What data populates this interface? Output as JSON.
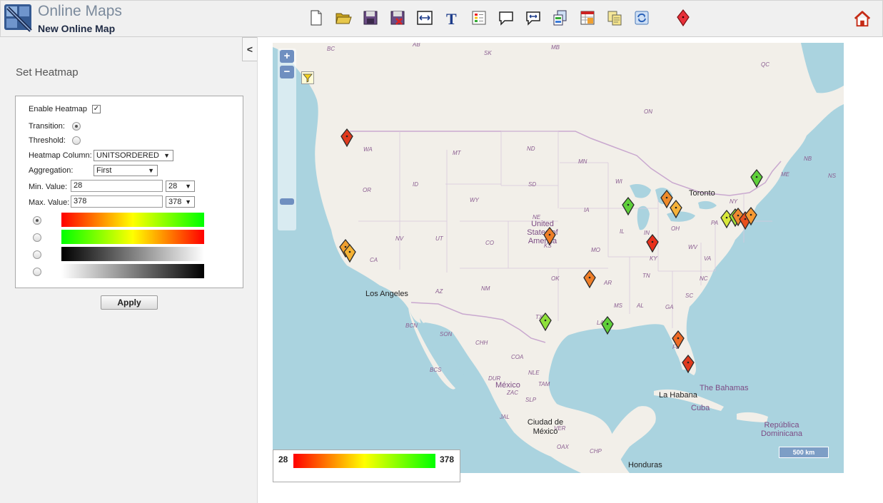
{
  "header": {
    "app_title": "Online Maps",
    "map_name": "New Online Map",
    "toolbar": [
      {
        "name": "new-document-icon",
        "title": "New"
      },
      {
        "name": "open-folder-icon",
        "title": "Open"
      },
      {
        "name": "save-icon",
        "title": "Save"
      },
      {
        "name": "save-as-icon",
        "title": "Save As"
      },
      {
        "name": "resize-icon",
        "title": "Resize"
      },
      {
        "name": "text-icon",
        "title": "Text"
      },
      {
        "name": "legend-icon",
        "title": "Legend"
      },
      {
        "name": "callout-icon",
        "title": "Callout"
      },
      {
        "name": "callout-arrows-icon",
        "title": "Callout Arrows"
      },
      {
        "name": "layer-export-icon",
        "title": "Export"
      },
      {
        "name": "layer-table-icon",
        "title": "Table"
      },
      {
        "name": "copy-icon",
        "title": "Copy"
      },
      {
        "name": "refresh-icon",
        "title": "Refresh"
      },
      {
        "name": "marker-icon",
        "title": "Marker"
      }
    ],
    "home_icon": "home-icon"
  },
  "panel": {
    "collapse_label": "<",
    "title": "Set Heatmap",
    "enable_label": "Enable Heatmap",
    "enable_checked": true,
    "transition_label": "Transition:",
    "threshold_label": "Threshold:",
    "mode_selected": "transition",
    "column_label": "Heatmap Column:",
    "column_value": "UNITSORDERED",
    "aggregation_label": "Aggregation:",
    "aggregation_value": "First",
    "min_label": "Min. Value:",
    "min_value": "28",
    "min_select": "28",
    "max_label": "Max. Value:",
    "max_value": "378",
    "max_select": "378",
    "palettes": [
      "red-yellow-green",
      "green-yellow-red",
      "black-white",
      "white-black"
    ],
    "palette_selected": 0,
    "apply_label": "Apply"
  },
  "map": {
    "zoom_in": "+",
    "zoom_out": "−",
    "scale_label": "500 km",
    "cities": [
      "Toronto",
      "Los Angeles",
      "La Habana",
      "Ciudad de México",
      "Honduras"
    ],
    "countries": [
      "United States of America",
      "México",
      "The Bahamas",
      "Cuba",
      "República Dominicana"
    ],
    "states": [
      "BC",
      "AB",
      "SK",
      "MB",
      "QC",
      "ON",
      "WA",
      "MT",
      "ND",
      "MN",
      "OR",
      "ID",
      "WY",
      "SD",
      "WI",
      "NE",
      "IA",
      "NV",
      "UT",
      "CO",
      "CA",
      "KS",
      "MO",
      "IL",
      "IN",
      "OH",
      "PA",
      "NY",
      "ME",
      "NB",
      "NS",
      "AZ",
      "NM",
      "OK",
      "AR",
      "TN",
      "KY",
      "WV",
      "VA",
      "NC",
      "SC",
      "GA",
      "AL",
      "MS",
      "LA",
      "TX",
      "FL",
      "BCN",
      "SON",
      "CHH",
      "COA",
      "NLE",
      "TAM",
      "DUR",
      "ZAC",
      "SLP",
      "BCS",
      "JAL",
      "VER",
      "OAX",
      "CHP"
    ],
    "markers": [
      {
        "state": "WA",
        "color": "#e03a1d"
      },
      {
        "state": "CA",
        "color": "#f0a030"
      },
      {
        "state": "CA",
        "color": "#f5b233"
      },
      {
        "state": "KS",
        "color": "#ee7e28"
      },
      {
        "state": "IL",
        "color": "#5fd03a"
      },
      {
        "state": "OH",
        "color": "#ee8a2a"
      },
      {
        "state": "OH",
        "color": "#f5b23a"
      },
      {
        "state": "KY",
        "color": "#e8301c"
      },
      {
        "state": "AR",
        "color": "#ee7e28"
      },
      {
        "state": "TX",
        "color": "#8ee03a"
      },
      {
        "state": "LA",
        "color": "#5fd03a"
      },
      {
        "state": "FL",
        "color": "#ee6a25"
      },
      {
        "state": "FL",
        "color": "#e03a1d"
      },
      {
        "state": "ME",
        "color": "#5fd03a"
      },
      {
        "state": "PA",
        "color": "#d8e83a"
      },
      {
        "state": "PA",
        "color": "#9ee03a"
      },
      {
        "state": "NY",
        "color": "#f08a30"
      },
      {
        "state": "NY",
        "color": "#e8501e"
      },
      {
        "state": "NY",
        "color": "#f59a33"
      }
    ]
  },
  "legend": {
    "min": "28",
    "max": "378",
    "colors": [
      "#ff0000",
      "#ffff00",
      "#00ff00"
    ]
  }
}
